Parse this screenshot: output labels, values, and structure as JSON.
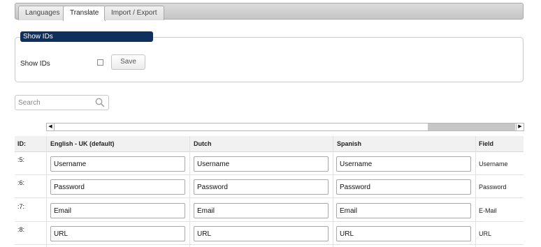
{
  "tabs": [
    {
      "label": "Languages",
      "active": false
    },
    {
      "label": "Translate",
      "active": true
    },
    {
      "label": "Import / Export",
      "active": false
    }
  ],
  "show_ids": {
    "legend": "Show IDs",
    "label": "Show IDs",
    "checked": false,
    "save_label": "Save"
  },
  "search": {
    "placeholder": "Search",
    "value": ""
  },
  "table": {
    "headers": {
      "id": "ID:",
      "english": "English - UK (default)",
      "dutch": "Dutch",
      "spanish": "Spanish",
      "field": "Field"
    },
    "rows": [
      {
        "id": ":5:",
        "english": "Username",
        "dutch": "Username",
        "spanish": "Username",
        "field": "Username"
      },
      {
        "id": ":6:",
        "english": "Password",
        "dutch": "Password",
        "spanish": "Password",
        "field": "Password"
      },
      {
        "id": ":7:",
        "english": "Email",
        "dutch": "Email",
        "spanish": "Email",
        "field": "E-Mail"
      },
      {
        "id": ":8:",
        "english": "URL",
        "dutch": "URL",
        "spanish": "URL",
        "field": "URL"
      }
    ]
  },
  "icons": {
    "search": "search-icon",
    "scroll_left": "arrow-left-icon",
    "scroll_right": "arrow-right-icon"
  }
}
